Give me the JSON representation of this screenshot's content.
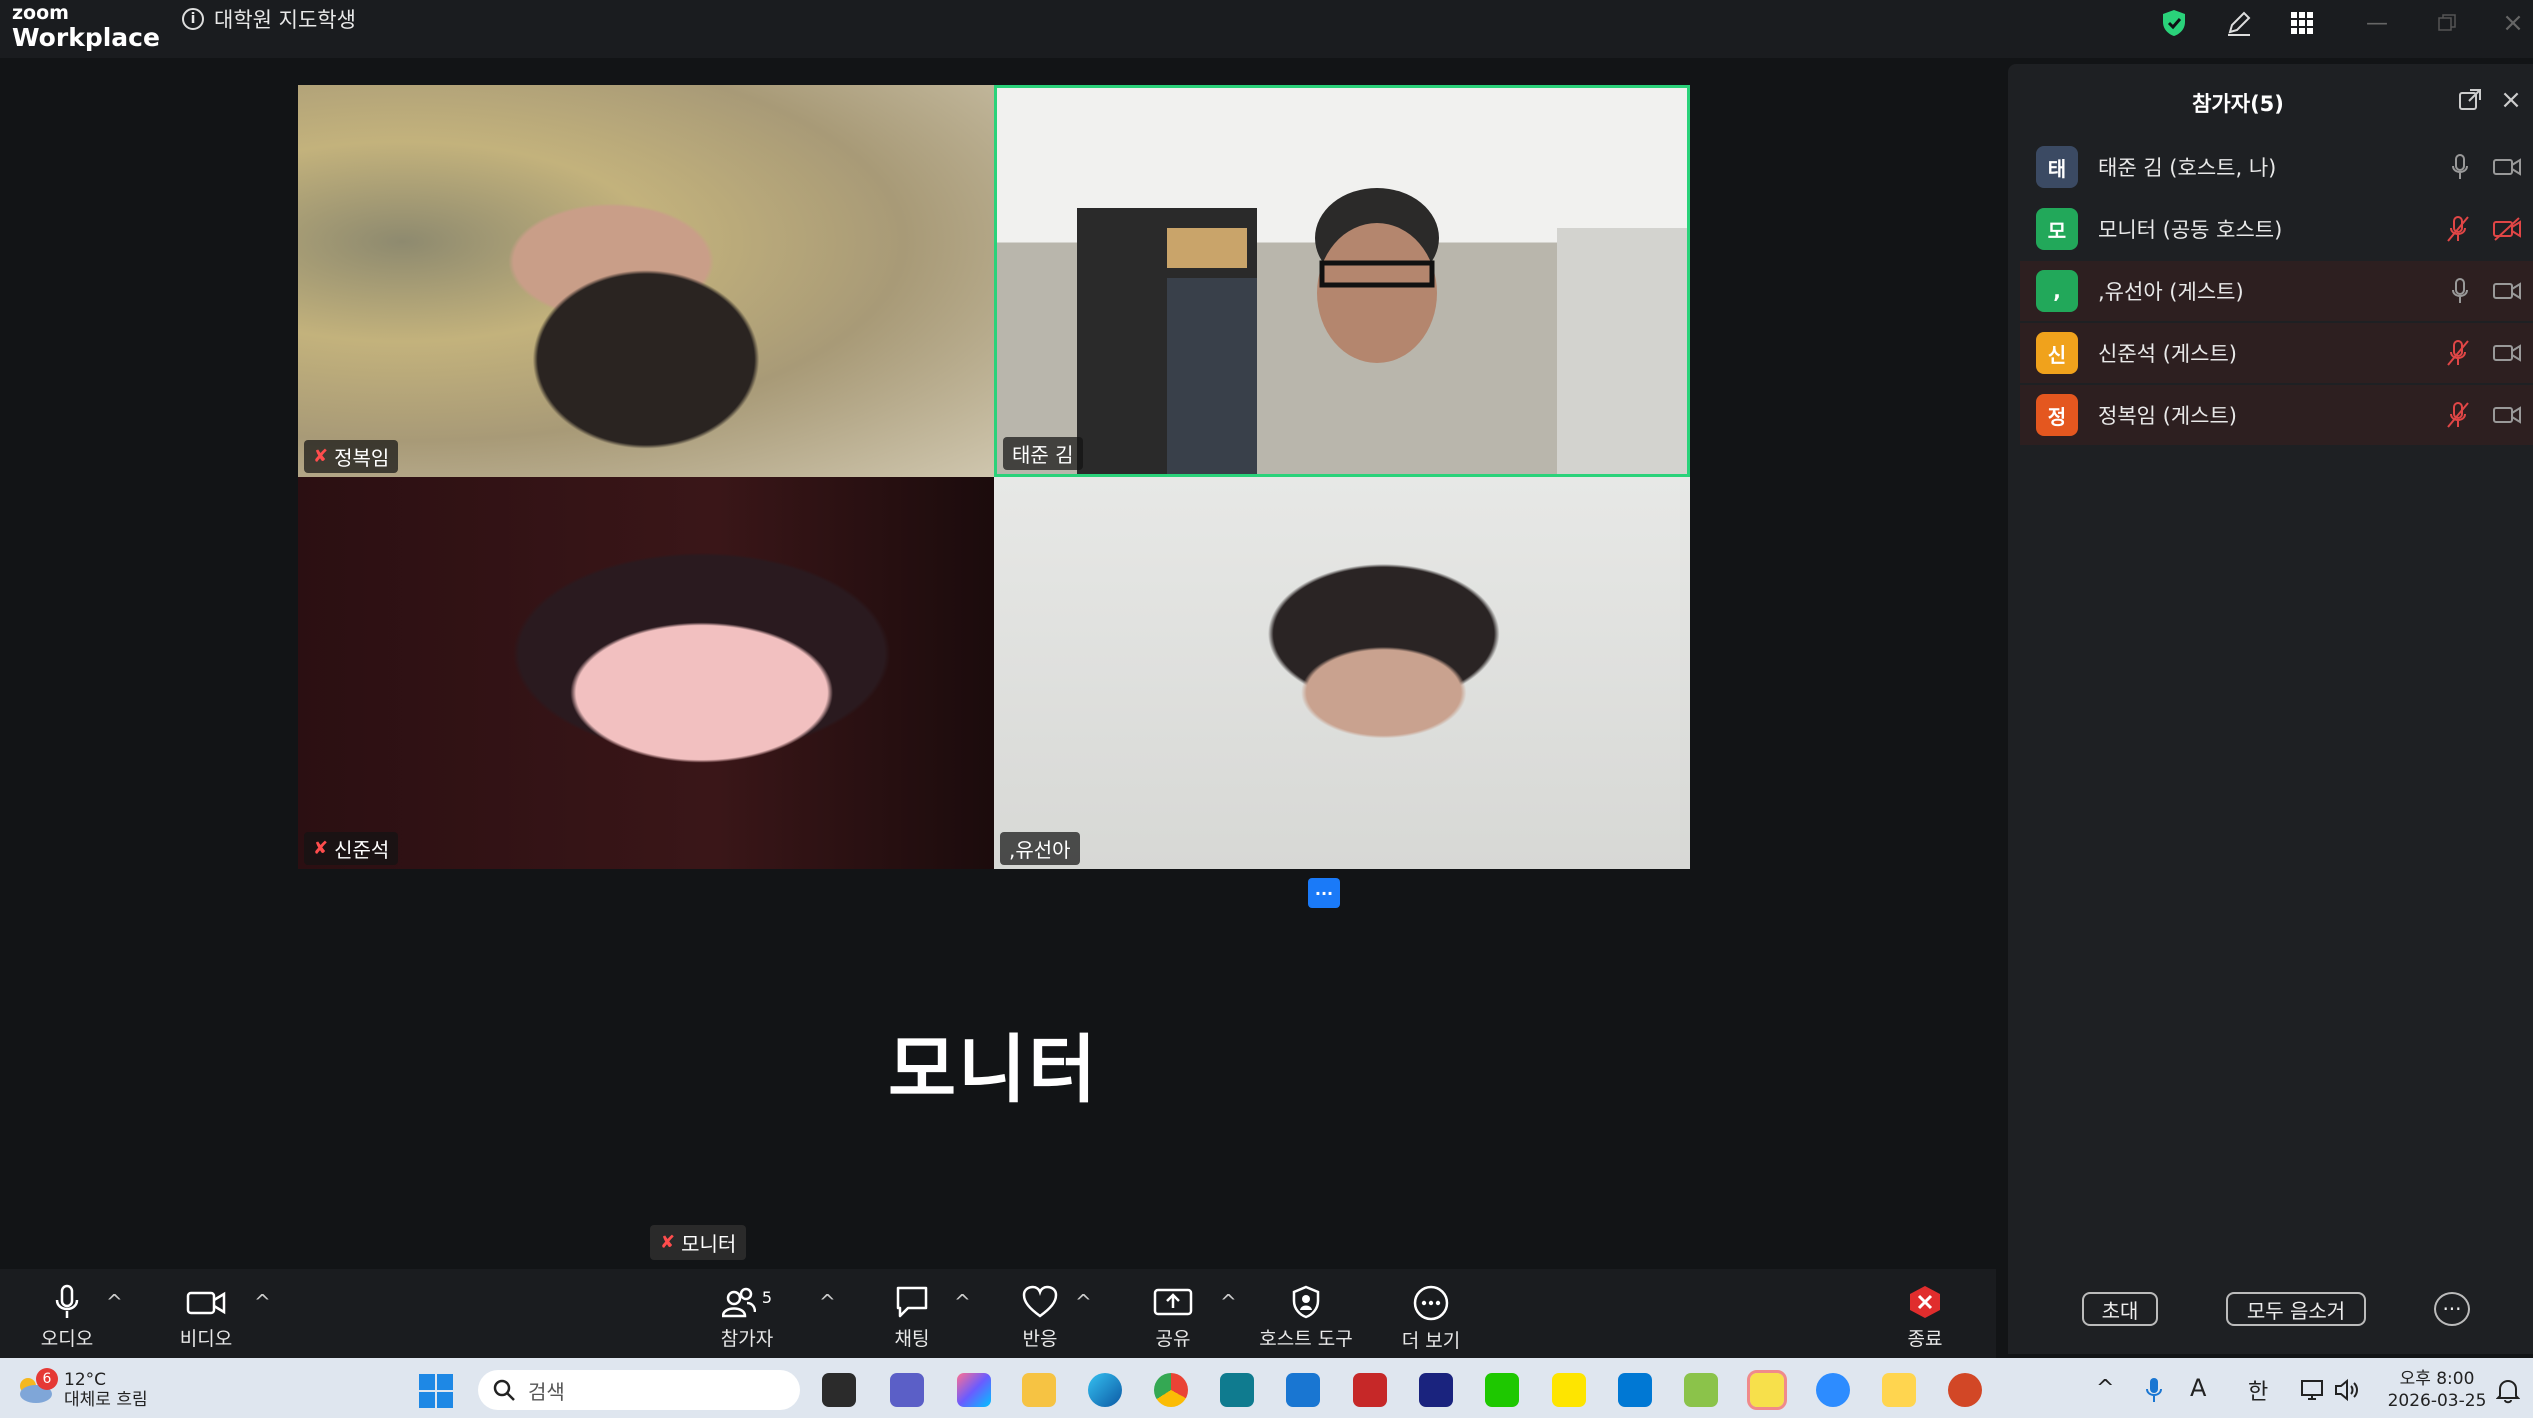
{
  "app": {
    "logo_top": "zoom",
    "logo_bottom": "Workplace",
    "meeting_title": "대학원 지도학생"
  },
  "tiles": [
    {
      "name": "정복임",
      "muted": true
    },
    {
      "name": "태준 김",
      "muted": false
    },
    {
      "name": "신준석",
      "muted": true
    },
    {
      "name": ",유선아",
      "muted": false
    }
  ],
  "tile_more": "···",
  "active_speaker": "모니터",
  "self_view": {
    "name": "모니터",
    "muted": true
  },
  "panel": {
    "title": "참가자(5)",
    "participants": [
      {
        "initial": "태",
        "name": "태준 김 (호스트, 나)",
        "color": "#3b4a63",
        "mic": "on",
        "video": "on"
      },
      {
        "initial": "모",
        "name": "모니터 (공동 호스트)",
        "color": "#22a85a",
        "mic": "muted",
        "video": "off"
      },
      {
        "initial": ",",
        "name": ",유선아 (게스트)",
        "color": "#22a85a",
        "mic": "on",
        "video": "on"
      },
      {
        "initial": "신",
        "name": "신준석 (게스트)",
        "color": "#f0a21c",
        "mic": "muted",
        "video": "on"
      },
      {
        "initial": "정",
        "name": "정복임 (게스트)",
        "color": "#e4571f",
        "mic": "muted",
        "video": "on"
      }
    ],
    "invite": "초대",
    "mute_all": "모두 음소거",
    "more": "···"
  },
  "toolbar": {
    "audio": "오디오",
    "video": "비디오",
    "participants": "참가자",
    "participants_count": "5",
    "chat": "채팅",
    "reactions": "반응",
    "share": "공유",
    "host_tools": "호스트 도구",
    "more": "더 보기",
    "end": "종료"
  },
  "taskbar": {
    "weather_badge": "6",
    "temp": "12°C",
    "weather": "대체로 흐림",
    "search": "검색",
    "ime_a": "A",
    "ime_han": "한",
    "time": "오후 8:00",
    "date": "2026-03-25"
  },
  "colors": {
    "accent": "#1a7af8",
    "active_border": "#2ad27a",
    "muted_red": "#ff4d4d",
    "end_red": "#e02d2d"
  }
}
